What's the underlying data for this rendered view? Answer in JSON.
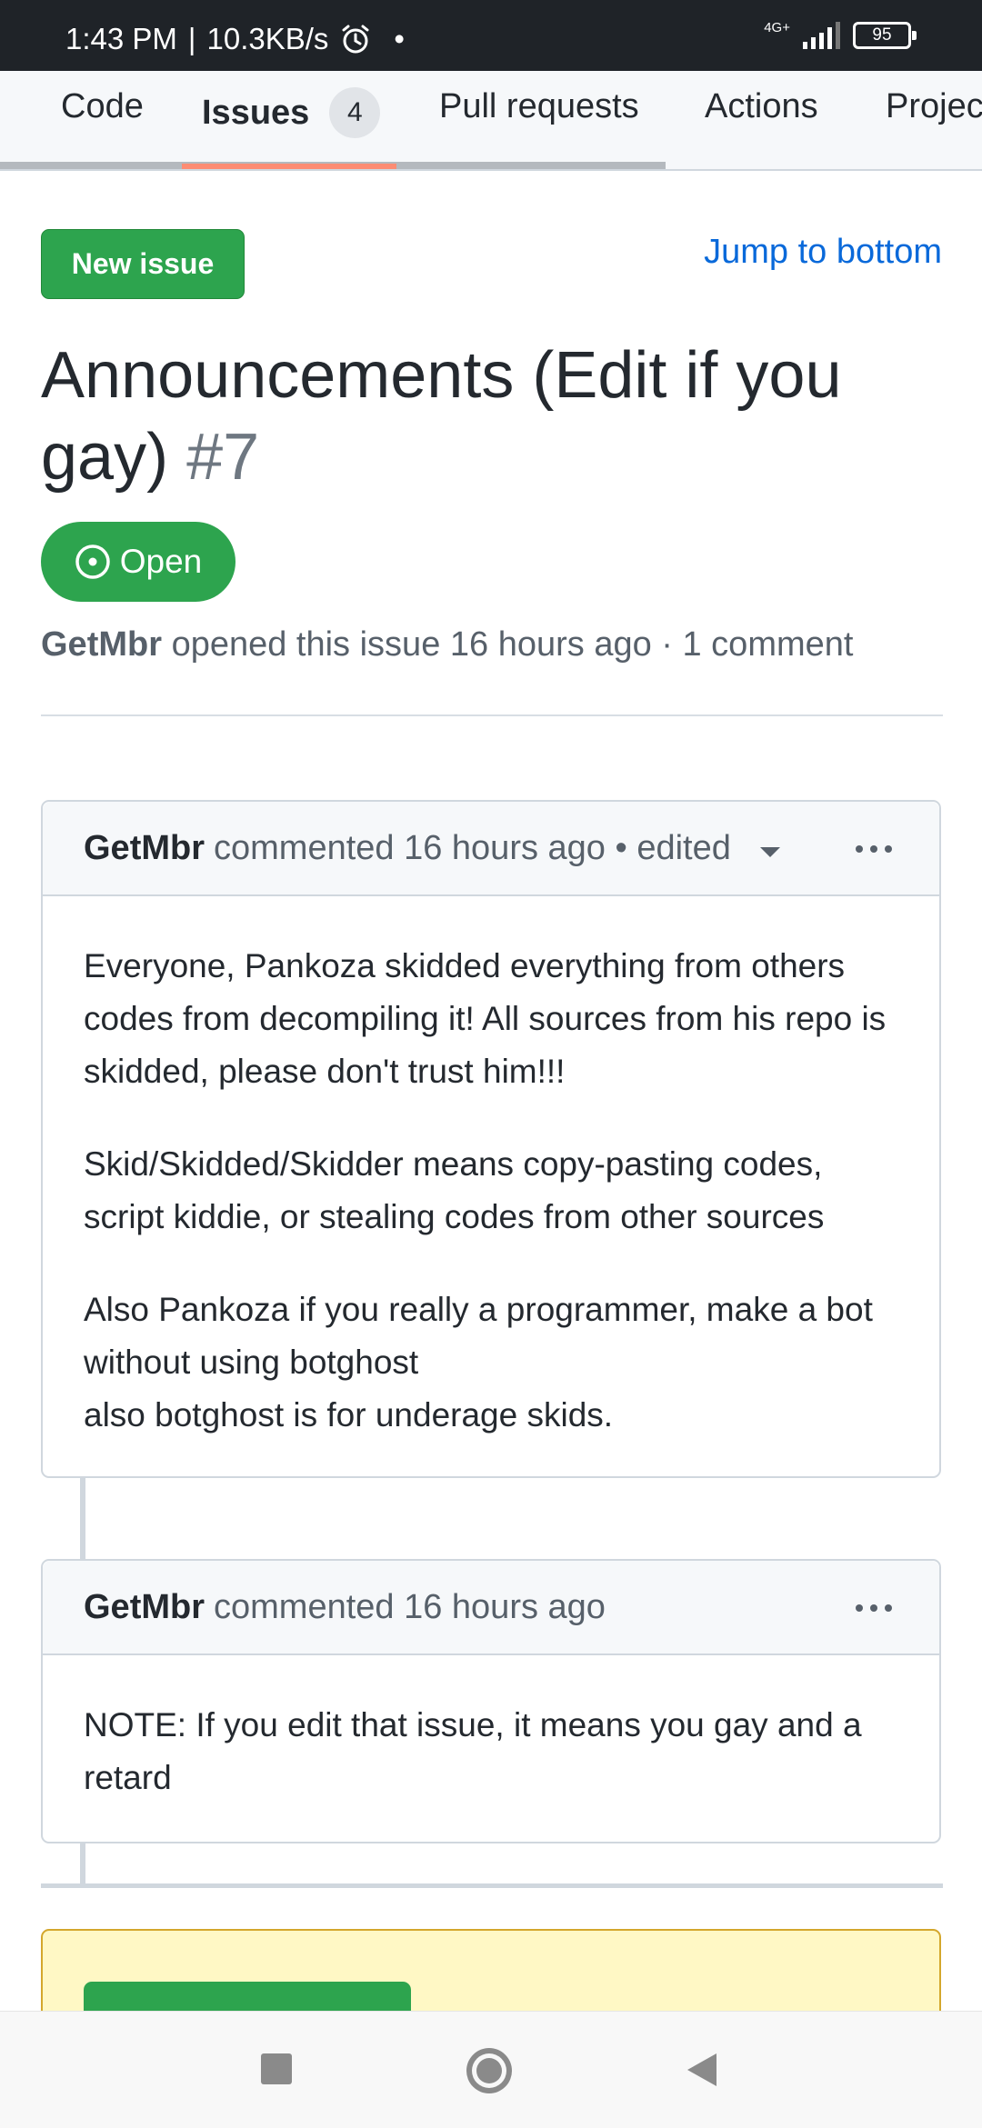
{
  "status_bar": {
    "time": "1:43 PM",
    "separator": "|",
    "speed": "10.3KB/s",
    "dot": "•",
    "network": "4G+",
    "battery": "95",
    "icons": [
      "alarm-icon",
      "signal-icon",
      "battery-icon"
    ]
  },
  "tabs": {
    "code": "Code",
    "issues": "Issues",
    "issues_count": "4",
    "pull_requests": "Pull requests",
    "actions": "Actions",
    "projects": "Projec"
  },
  "actions": {
    "new_issue": "New issue",
    "jump_to_bottom": "Jump to bottom"
  },
  "issue": {
    "title": "Announcements (Edit if you gay)",
    "number": "#7",
    "state": "Open",
    "author": "GetMbr",
    "opened_text": "opened this issue 16 hours ago · 1 comment"
  },
  "comments": [
    {
      "author": "GetMbr",
      "meta": "commented 16 hours ago • edited",
      "paragraphs": [
        "Everyone, Pankoza skidded everything from others codes from decompiling it! All sources from his repo is skidded, please don't trust him!!!",
        "Skid/Skidded/Skidder means copy-pasting codes, script kiddie, or stealing codes from other sources",
        "Also Pankoza if you really a programmer, make a bot without using botghost"
      ],
      "extra_line": "also botghost is for underage skids."
    },
    {
      "author": "GetMbr",
      "meta": "commented 16 hours ago",
      "paragraphs": [
        "NOTE: If you edit that issue, it means you gay and a retard"
      ]
    }
  ],
  "colors": {
    "primary_button": "#2da44e",
    "link": "#0969da",
    "tab_underline": "#fd8c73",
    "notice_bg": "#fff8c5"
  }
}
